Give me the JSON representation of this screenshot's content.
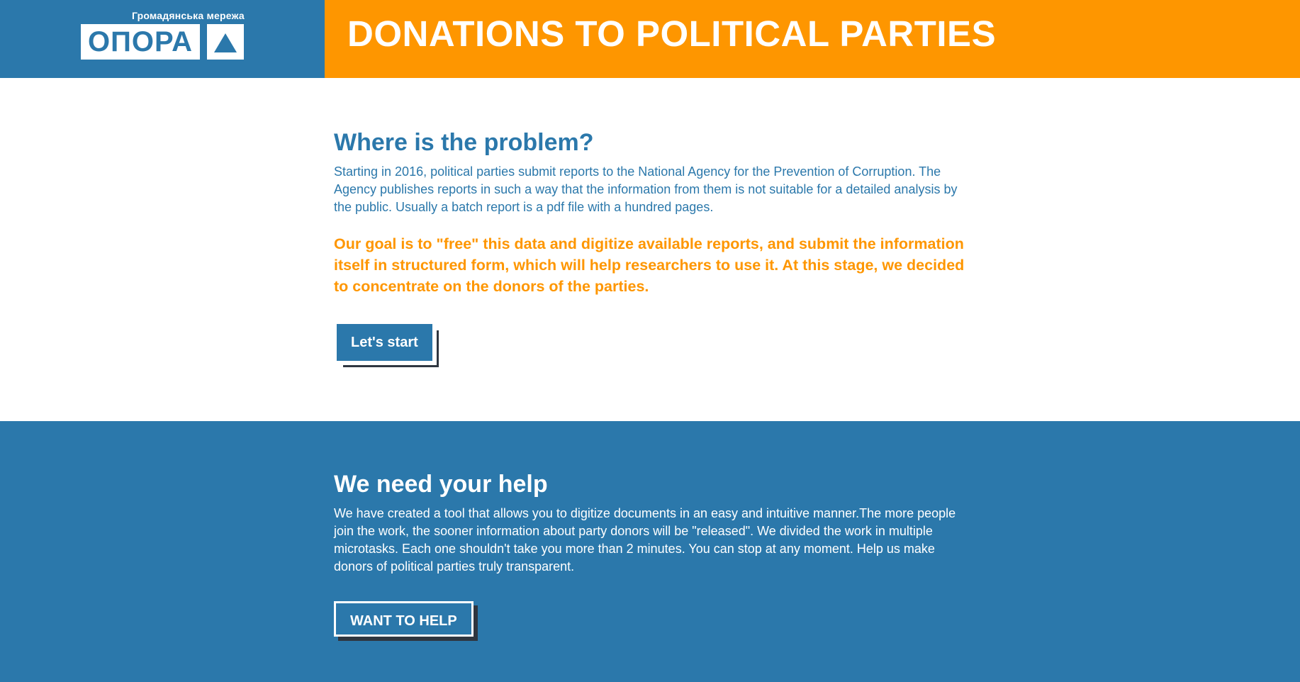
{
  "header": {
    "logo_subtitle": "Громадянська мережа",
    "logo_text": "ОПОРА",
    "title": "DONATIONS TO POLITICAL PARTIES"
  },
  "problem": {
    "heading": "Where is the problem?",
    "description": "Starting in 2016, political parties submit reports to the National Agency for the Prevention of Corruption. The Agency publishes reports in such a way that the information from them is not suitable for a detailed analysis by the public. Usually a batch report is a pdf file with a hundred pages.",
    "goal": "Our goal is to \"free\" this data and digitize available reports, and submit the information itself in structured form, which will help researchers to use it. At this stage, we decided to concentrate on the donors of the parties.",
    "button_label": "Let's start"
  },
  "help": {
    "heading": "We need your help",
    "description": "We have created a tool that allows you to digitize documents in an easy and intuitive manner.The more people join the work, the sooner information about party donors will be \"released\". We divided the work in multiple microtasks. Each one shouldn't take you more than 2 minutes. You can stop at any moment. Help us make donors of political parties truly transparent.",
    "button_label": "WANT TO HELP"
  },
  "colors": {
    "brand_blue": "#2b78ab",
    "brand_orange": "#fe9600",
    "shadow_dark": "#2f3640"
  },
  "icons": {
    "logo_mark": "triangle-icon"
  }
}
